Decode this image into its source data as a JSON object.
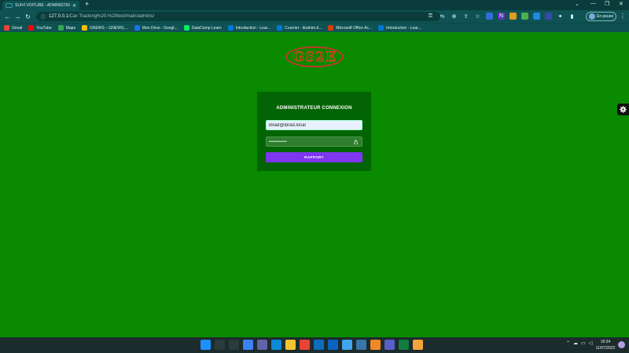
{
  "browser": {
    "tab_title": "SUIVI VOITURE - ADMINISTRATEU",
    "new_tab": "+",
    "url_host": "127.0.0.1",
    "url_path": "/Car-Tracking%20-%20test/main/admins/",
    "profile_label": "En pause",
    "window_controls": [
      "⌄",
      "—",
      "❐",
      "✕"
    ],
    "bookmarks": [
      {
        "label": "Gmail",
        "icon": "gmail-icon",
        "color": "#ea4335"
      },
      {
        "label": "YouTube",
        "icon": "youtube-icon",
        "color": "#ff0000"
      },
      {
        "label": "Maps",
        "icon": "maps-icon",
        "color": "#34a853"
      },
      {
        "label": "GNEWS – GNEWS,...",
        "icon": "gnews-icon",
        "color": "#fbbc05"
      },
      {
        "label": "Mon Drive - Googl...",
        "icon": "drive-icon",
        "color": "#1a73e8"
      },
      {
        "label": "DataCamp Learn",
        "icon": "datacamp-icon",
        "color": "#03ef62"
      },
      {
        "label": "Introduction - Lear...",
        "icon": "bookmark-icon",
        "color": "#0078d4"
      },
      {
        "label": "Courrier - ibrahim.d...",
        "icon": "outlook-icon",
        "color": "#0078d4"
      },
      {
        "label": "Microsoft Office Ac...",
        "icon": "office-icon",
        "color": "#d83b01"
      },
      {
        "label": "Introduction - Lear...",
        "icon": "bookmark-icon",
        "color": "#0078d4"
      }
    ]
  },
  "page": {
    "logo_text": "GS2E",
    "form_title": "ADMINISTRATEUR CONNEXION",
    "email_value": "ibrad@ibrad.local",
    "password_mask": "•••••••••••••",
    "submit_label": "RAPPORT",
    "colors": {
      "background": "#098a00",
      "card": "#036403",
      "button": "#7f36f0",
      "logo_ring": "#c0392b"
    }
  },
  "taskbar": {
    "apps": [
      {
        "icon": "windows-start-icon",
        "color": "#1e90ff"
      },
      {
        "icon": "search-icon",
        "color": "#2b3b3b"
      },
      {
        "icon": "task-view-icon",
        "color": "#2b3b3b"
      },
      {
        "icon": "widgets-icon",
        "color": "#3b82f6"
      },
      {
        "icon": "teams-chat-icon",
        "color": "#6264a7"
      },
      {
        "icon": "edge-icon",
        "color": "#0c8ad6"
      },
      {
        "icon": "file-explorer-icon",
        "color": "#f4c430"
      },
      {
        "icon": "chrome-icon",
        "color": "#ea4335"
      },
      {
        "icon": "store-icon",
        "color": "#0f6cbd"
      },
      {
        "icon": "outlook-icon",
        "color": "#0a64c4"
      },
      {
        "icon": "document-icon",
        "color": "#41a5ee"
      },
      {
        "icon": "python-icon",
        "color": "#3776ab"
      },
      {
        "icon": "vlc-icon",
        "color": "#f08a24"
      },
      {
        "icon": "teams-icon",
        "color": "#5b5fc7"
      },
      {
        "icon": "excel-icon",
        "color": "#107c41"
      },
      {
        "icon": "sublime-icon",
        "color": "#f2a33a"
      }
    ],
    "time": "16:34",
    "date": "11/07/2022"
  }
}
